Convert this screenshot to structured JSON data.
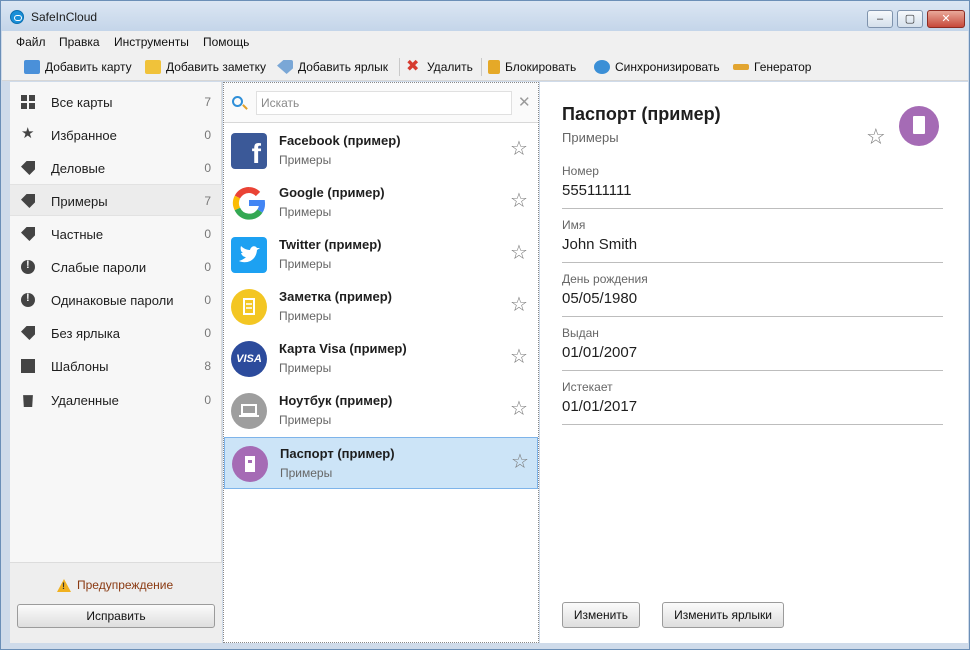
{
  "window": {
    "title": "SafeInCloud",
    "minimize": "–",
    "maximize": "▢",
    "close": "✕"
  },
  "menu": [
    "Файл",
    "Правка",
    "Инструменты",
    "Помощь"
  ],
  "toolbar": {
    "add_card": "Добавить карту",
    "add_note": "Добавить заметку",
    "add_label": "Добавить ярлык",
    "delete": "Удалить",
    "lock": "Блокировать",
    "sync": "Синхронизировать",
    "generator": "Генератор"
  },
  "sidebar": {
    "items": [
      {
        "label": "Все карты",
        "count": "7",
        "icon": "grid-icon"
      },
      {
        "label": "Избранное",
        "count": "0",
        "icon": "star-icon"
      },
      {
        "label": "Деловые",
        "count": "0",
        "icon": "tag-icon"
      },
      {
        "label": "Примеры",
        "count": "7",
        "icon": "tag-icon"
      },
      {
        "label": "Частные",
        "count": "0",
        "icon": "tag-icon"
      },
      {
        "label": "Слабые пароли",
        "count": "0",
        "icon": "alert-icon"
      },
      {
        "label": "Одинаковые пароли",
        "count": "0",
        "icon": "alert-icon"
      },
      {
        "label": "Без ярлыка",
        "count": "0",
        "icon": "no-label-icon"
      },
      {
        "label": "Шаблоны",
        "count": "8",
        "icon": "templates-icon"
      },
      {
        "label": "Удаленные",
        "count": "0",
        "icon": "trash-icon"
      }
    ],
    "selected": 3,
    "warning": "Предупреждение",
    "fix_button": "Исправить"
  },
  "search": {
    "placeholder": "Искать",
    "clear": "✕"
  },
  "entries": [
    {
      "title": "Facebook (пример)",
      "subtitle": "Примеры",
      "logo": "facebook-logo"
    },
    {
      "title": "Google (пример)",
      "subtitle": "Примеры",
      "logo": "google-logo"
    },
    {
      "title": "Twitter (пример)",
      "subtitle": "Примеры",
      "logo": "twitter-logo"
    },
    {
      "title": "Заметка (пример)",
      "subtitle": "Примеры",
      "logo": "note-logo"
    },
    {
      "title": "Карта Visa (пример)",
      "subtitle": "Примеры",
      "logo": "visa-logo"
    },
    {
      "title": "Ноутбук (пример)",
      "subtitle": "Примеры",
      "logo": "laptop-logo"
    },
    {
      "title": "Паспорт (пример)",
      "subtitle": "Примеры",
      "logo": "passport-logo"
    }
  ],
  "selected_entry": 6,
  "detail": {
    "title": "Паспорт (пример)",
    "subtitle": "Примеры",
    "fields": [
      {
        "label": "Номер",
        "value": "555111111"
      },
      {
        "label": "Имя",
        "value": "John Smith"
      },
      {
        "label": "День рождения",
        "value": "05/05/1980"
      },
      {
        "label": "Выдан",
        "value": "01/01/2007"
      },
      {
        "label": "Истекает",
        "value": "01/01/2017"
      }
    ],
    "edit_button": "Изменить",
    "edit_labels_button": "Изменить ярлыки"
  },
  "colors": {
    "selection": "#cce4f7",
    "accent": "#2f8fd8",
    "passport": "#a56bb5"
  }
}
